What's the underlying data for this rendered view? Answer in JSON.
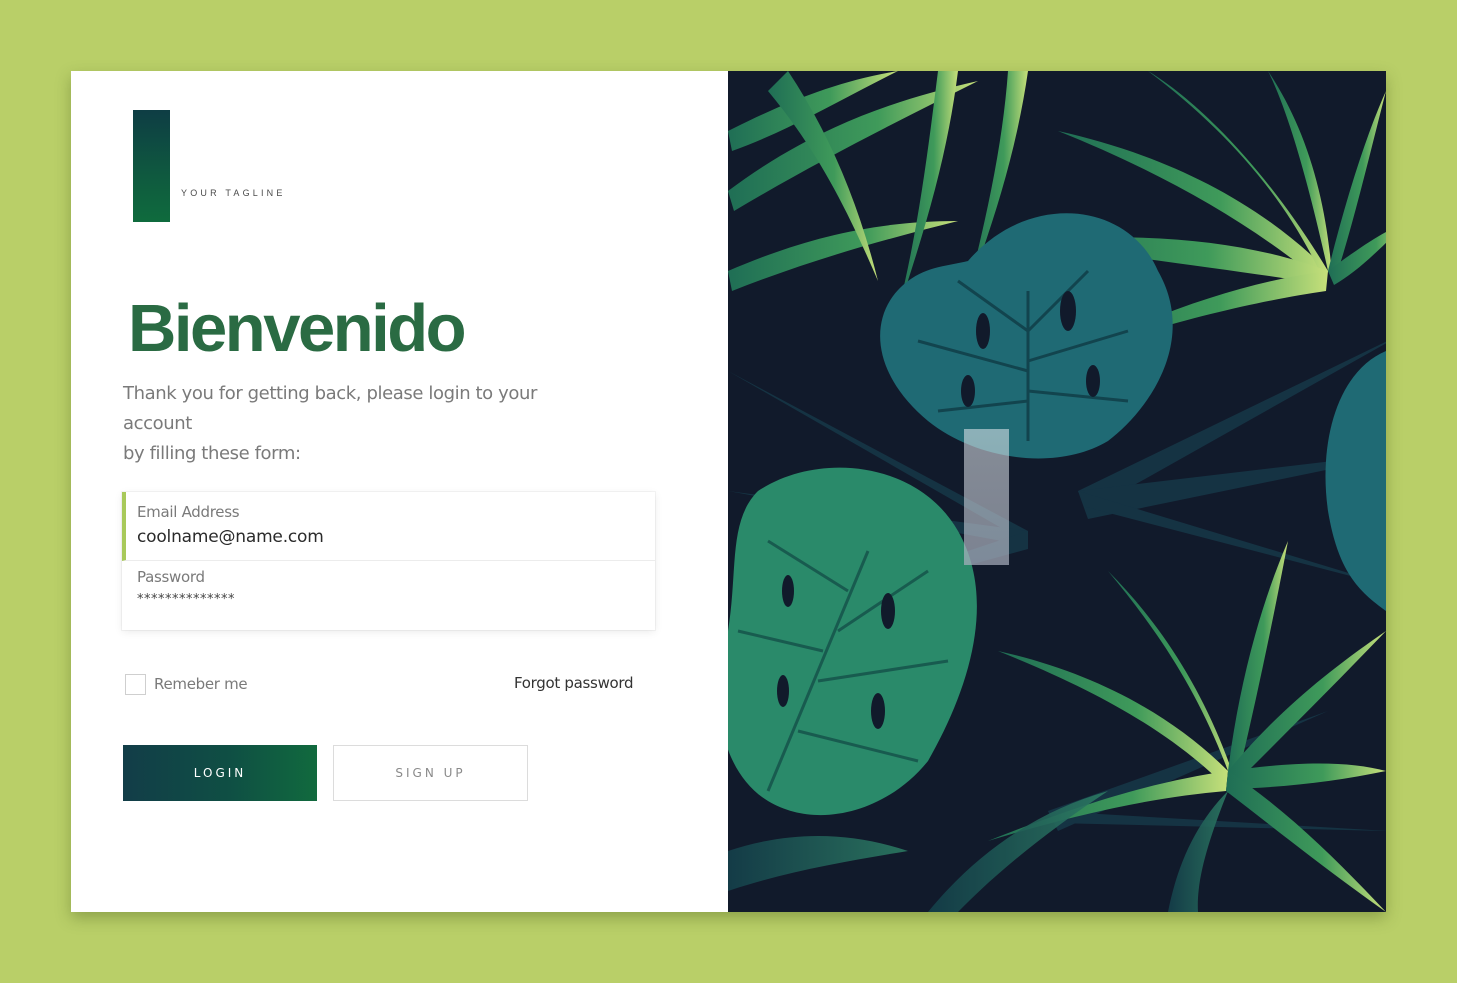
{
  "brand": {
    "tagline": "YOUR TAGLINE"
  },
  "welcome": {
    "title": "Bienvenido",
    "subtitle_line1": "Thank you for getting back, please login to your account",
    "subtitle_line2": "by filling these form:"
  },
  "form": {
    "email": {
      "label": "Email Address",
      "value": "coolname@name.com"
    },
    "password": {
      "label": "Password",
      "value": "**************"
    },
    "remember_label": "Remeber me",
    "remember_checked": false,
    "forgot_label": "Forgot password"
  },
  "buttons": {
    "login": "LOGIN",
    "signup": "SIGN UP"
  },
  "colors": {
    "page_background": "#b9cf68",
    "brand_green": "#2a6b43",
    "accent_lime": "#a8c95a",
    "login_gradient_start": "#123d48",
    "login_gradient_end": "#116a3e",
    "panel_dark": "#101a2a"
  },
  "illustration": {
    "subject": "tropical-leaves"
  }
}
